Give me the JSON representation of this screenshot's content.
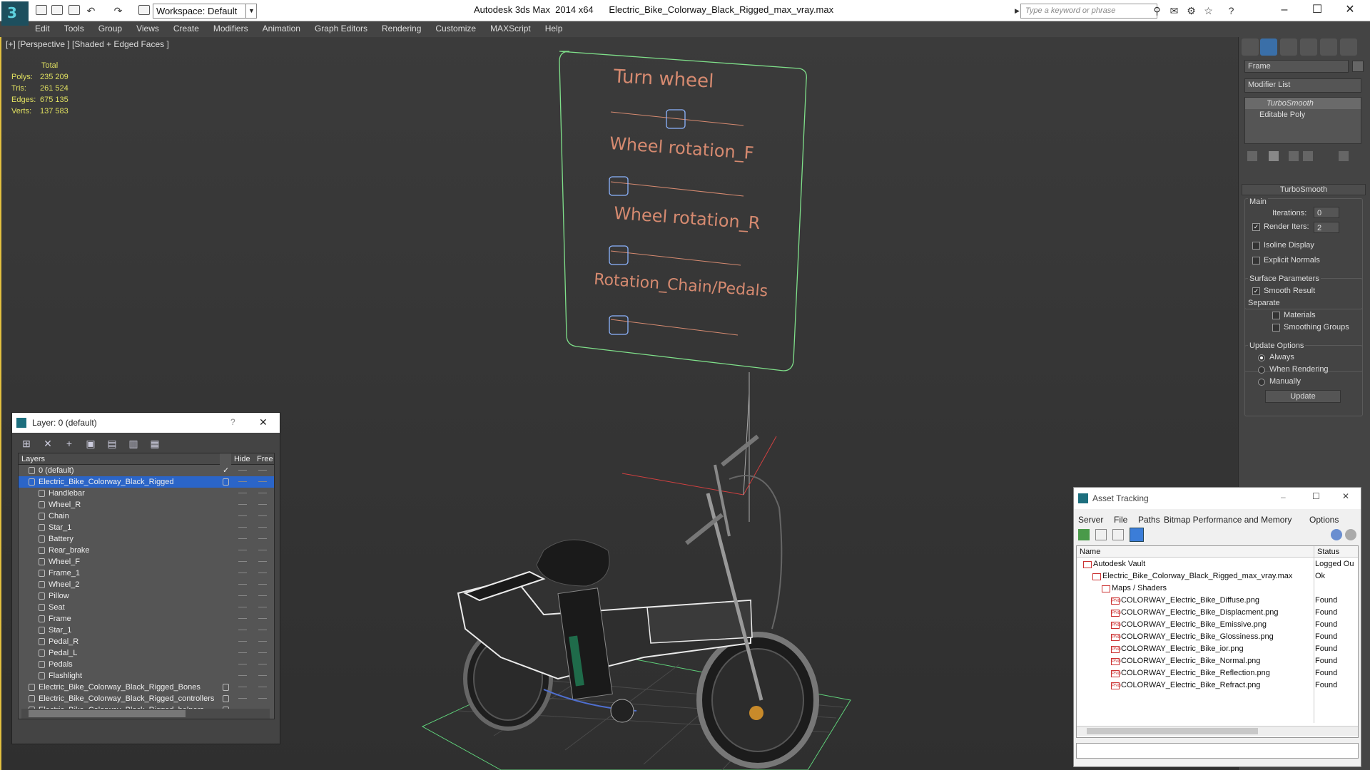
{
  "titlebar": {
    "workspace_label": "Workspace: Default",
    "app_title": "Autodesk 3ds Max  2014 x64      Electric_Bike_Colorway_Black_Rigged_max_vray.max",
    "search_placeholder": "Type a keyword or phrase",
    "minimize": "–",
    "maximize": "☐",
    "close": "✕"
  },
  "menu": [
    "Edit",
    "Tools",
    "Group",
    "Views",
    "Create",
    "Modifiers",
    "Animation",
    "Graph Editors",
    "Rendering",
    "Customize",
    "MAXScript",
    "Help"
  ],
  "viewport": {
    "label": "[+] [Perspective ] [Shaded + Edged Faces ]",
    "stats_header": "Total",
    "stats": [
      {
        "label": "Polys:",
        "value": "235 209"
      },
      {
        "label": "Tris:",
        "value": "261 524"
      },
      {
        "label": "Edges:",
        "value": "675 135"
      },
      {
        "label": "Verts:",
        "value": "137 583"
      }
    ],
    "controls": [
      "Turn wheel",
      "Wheel rotation_F",
      "Wheel rotation_R",
      "Rotation_Chain/Pedals"
    ],
    "colors": {
      "spline": "#d68a70",
      "panel_frame": "#7fe08a",
      "wire": "#ffffff"
    }
  },
  "command_panel": {
    "object_name": "Frame",
    "modifier_list": "Modifier List",
    "stack": [
      "TurboSmooth",
      "Editable Poly"
    ],
    "rollout_title": "TurboSmooth",
    "main_label": "Main",
    "iterations_label": "Iterations:",
    "iterations_value": "0",
    "render_iters_label": "Render Iters:",
    "render_iters_value": "2",
    "isoline": "Isoline Display",
    "explicit_normals": "Explicit Normals",
    "surface_params": "Surface Parameters",
    "smooth_result": "Smooth Result",
    "separate": "Separate",
    "materials": "Materials",
    "smoothing_groups": "Smoothing Groups",
    "update_options": "Update Options",
    "always": "Always",
    "when_rendering": "When Rendering",
    "manually": "Manually",
    "update_button": "Update"
  },
  "layer_window": {
    "title": "Layer: 0 (default)",
    "help": "?",
    "close": "✕",
    "col_layers": "Layers",
    "col_hide": "Hide",
    "col_freeze": "Free",
    "rows": [
      {
        "name": "0 (default)",
        "level": 0,
        "type": "layer",
        "checked": true
      },
      {
        "name": "Electric_Bike_Colorway_Black_Rigged",
        "level": 0,
        "type": "layer",
        "selected": true
      },
      {
        "name": "Handlebar",
        "level": 1,
        "type": "obj"
      },
      {
        "name": "Wheel_R",
        "level": 1,
        "type": "obj"
      },
      {
        "name": "Chain",
        "level": 1,
        "type": "obj"
      },
      {
        "name": "Star_1",
        "level": 1,
        "type": "obj"
      },
      {
        "name": "Battery",
        "level": 1,
        "type": "obj"
      },
      {
        "name": "Rear_brake",
        "level": 1,
        "type": "obj"
      },
      {
        "name": "Wheel_F",
        "level": 1,
        "type": "obj"
      },
      {
        "name": "Frame_1",
        "level": 1,
        "type": "obj"
      },
      {
        "name": "Wheel_2",
        "level": 1,
        "type": "obj"
      },
      {
        "name": "Pillow",
        "level": 1,
        "type": "obj"
      },
      {
        "name": "Seat",
        "level": 1,
        "type": "obj"
      },
      {
        "name": "Frame",
        "level": 1,
        "type": "obj"
      },
      {
        "name": "Star_1",
        "level": 1,
        "type": "obj"
      },
      {
        "name": "Pedal_R",
        "level": 1,
        "type": "obj"
      },
      {
        "name": "Pedal_L",
        "level": 1,
        "type": "obj"
      },
      {
        "name": "Pedals",
        "level": 1,
        "type": "obj"
      },
      {
        "name": "Flashlight",
        "level": 1,
        "type": "obj"
      },
      {
        "name": "Electric_Bike_Colorway_Black_Rigged_Bones",
        "level": 0,
        "type": "layer",
        "box": true
      },
      {
        "name": "Electric_Bike_Colorway_Black_Rigged_controllers",
        "level": 0,
        "type": "layer",
        "box": true
      },
      {
        "name": "Electric_Bike_Colorway_Black_Rigged_helpers",
        "level": 0,
        "type": "layer",
        "box": true
      }
    ]
  },
  "asset_window": {
    "title": "Asset Tracking",
    "menu": [
      "Server",
      "File",
      "Paths",
      "Bitmap Performance and Memory",
      "Options"
    ],
    "col_name": "Name",
    "col_status": "Status",
    "rows": [
      {
        "name": "Autodesk Vault",
        "status": "Logged Ou",
        "level": 1
      },
      {
        "name": "Electric_Bike_Colorway_Black_Rigged_max_vray.max",
        "status": "Ok",
        "level": 2
      },
      {
        "name": "Maps / Shaders",
        "status": "",
        "level": 3
      },
      {
        "name": "COLORWAY_Electric_Bike_Diffuse.png",
        "status": "Found",
        "level": 4
      },
      {
        "name": "COLORWAY_Electric_Bike_Displacment.png",
        "status": "Found",
        "level": 4
      },
      {
        "name": "COLORWAY_Electric_Bike_Emissive.png",
        "status": "Found",
        "level": 4
      },
      {
        "name": "COLORWAY_Electric_Bike_Glossiness.png",
        "status": "Found",
        "level": 4
      },
      {
        "name": "COLORWAY_Electric_Bike_ior.png",
        "status": "Found",
        "level": 4
      },
      {
        "name": "COLORWAY_Electric_Bike_Normal.png",
        "status": "Found",
        "level": 4
      },
      {
        "name": "COLORWAY_Electric_Bike_Reflection.png",
        "status": "Found",
        "level": 4
      },
      {
        "name": "COLORWAY_Electric_Bike_Refract.png",
        "status": "Found",
        "level": 4
      }
    ]
  }
}
